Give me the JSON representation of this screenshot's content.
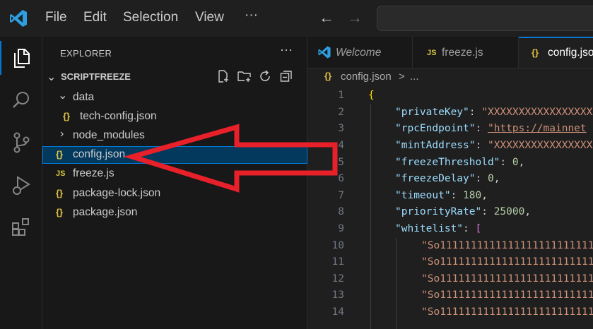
{
  "menu": {
    "file": "File",
    "edit": "Edit",
    "selection": "Selection",
    "view": "View",
    "more": "···"
  },
  "explorer": {
    "title": "EXPLORER",
    "more": "···",
    "folder": "SCRIPTFREEZE",
    "items": [
      {
        "label": "data",
        "type": "folder",
        "expanded": true
      },
      {
        "label": "tech-config.json",
        "type": "json"
      },
      {
        "label": "node_modules",
        "type": "folder",
        "expanded": false
      },
      {
        "label": "config.json",
        "type": "json",
        "selected": true
      },
      {
        "label": "freeze.js",
        "type": "js"
      },
      {
        "label": "package-lock.json",
        "type": "json"
      },
      {
        "label": "package.json",
        "type": "json"
      }
    ]
  },
  "tabs": [
    {
      "label": "Welcome",
      "active": false
    },
    {
      "label": "freeze.js",
      "active": false
    },
    {
      "label": "config.json",
      "active": true
    }
  ],
  "breadcrumb": {
    "file": "config.json",
    "sep": ">",
    "rest": "..."
  },
  "icons": {
    "json": "{}",
    "js": "JS"
  },
  "editor": {
    "line_numbers": [
      "1",
      "2",
      "3",
      "4",
      "5",
      "6",
      "7",
      "8",
      "9",
      "10",
      "11",
      "12",
      "13",
      "14"
    ],
    "lines": {
      "l1": "{",
      "k2": "\"privateKey\"",
      "v2": "\"XXXXXXXXXXXXXXXXXXXXX",
      "k3": "\"rpcEndpoint\"",
      "v3": "\"https://mainnet",
      "k4": "\"mintAddress\"",
      "v4": "\"XXXXXXXXXXXXXXXXXXXXX",
      "k5": "\"freezeThreshold\"",
      "v5": "0",
      "k6": "\"freezeDelay\"",
      "v6": "0",
      "k7": "\"timeout\"",
      "v7": "180",
      "k8": "\"priorityRate\"",
      "v8": "25000",
      "k9": "\"whitelist\"",
      "v9": "[",
      "w10": "\"So1111111111111111111111111",
      "w11": "\"So1111111111111111111111111",
      "w12": "\"So1111111111111111111111111",
      "w13": "\"So1111111111111111111111111",
      "w14": "\"So1111111111111111111111111"
    }
  },
  "colors": {
    "accent": "#0078d4",
    "selection": "#04395e",
    "arrow": "#e8202a"
  }
}
